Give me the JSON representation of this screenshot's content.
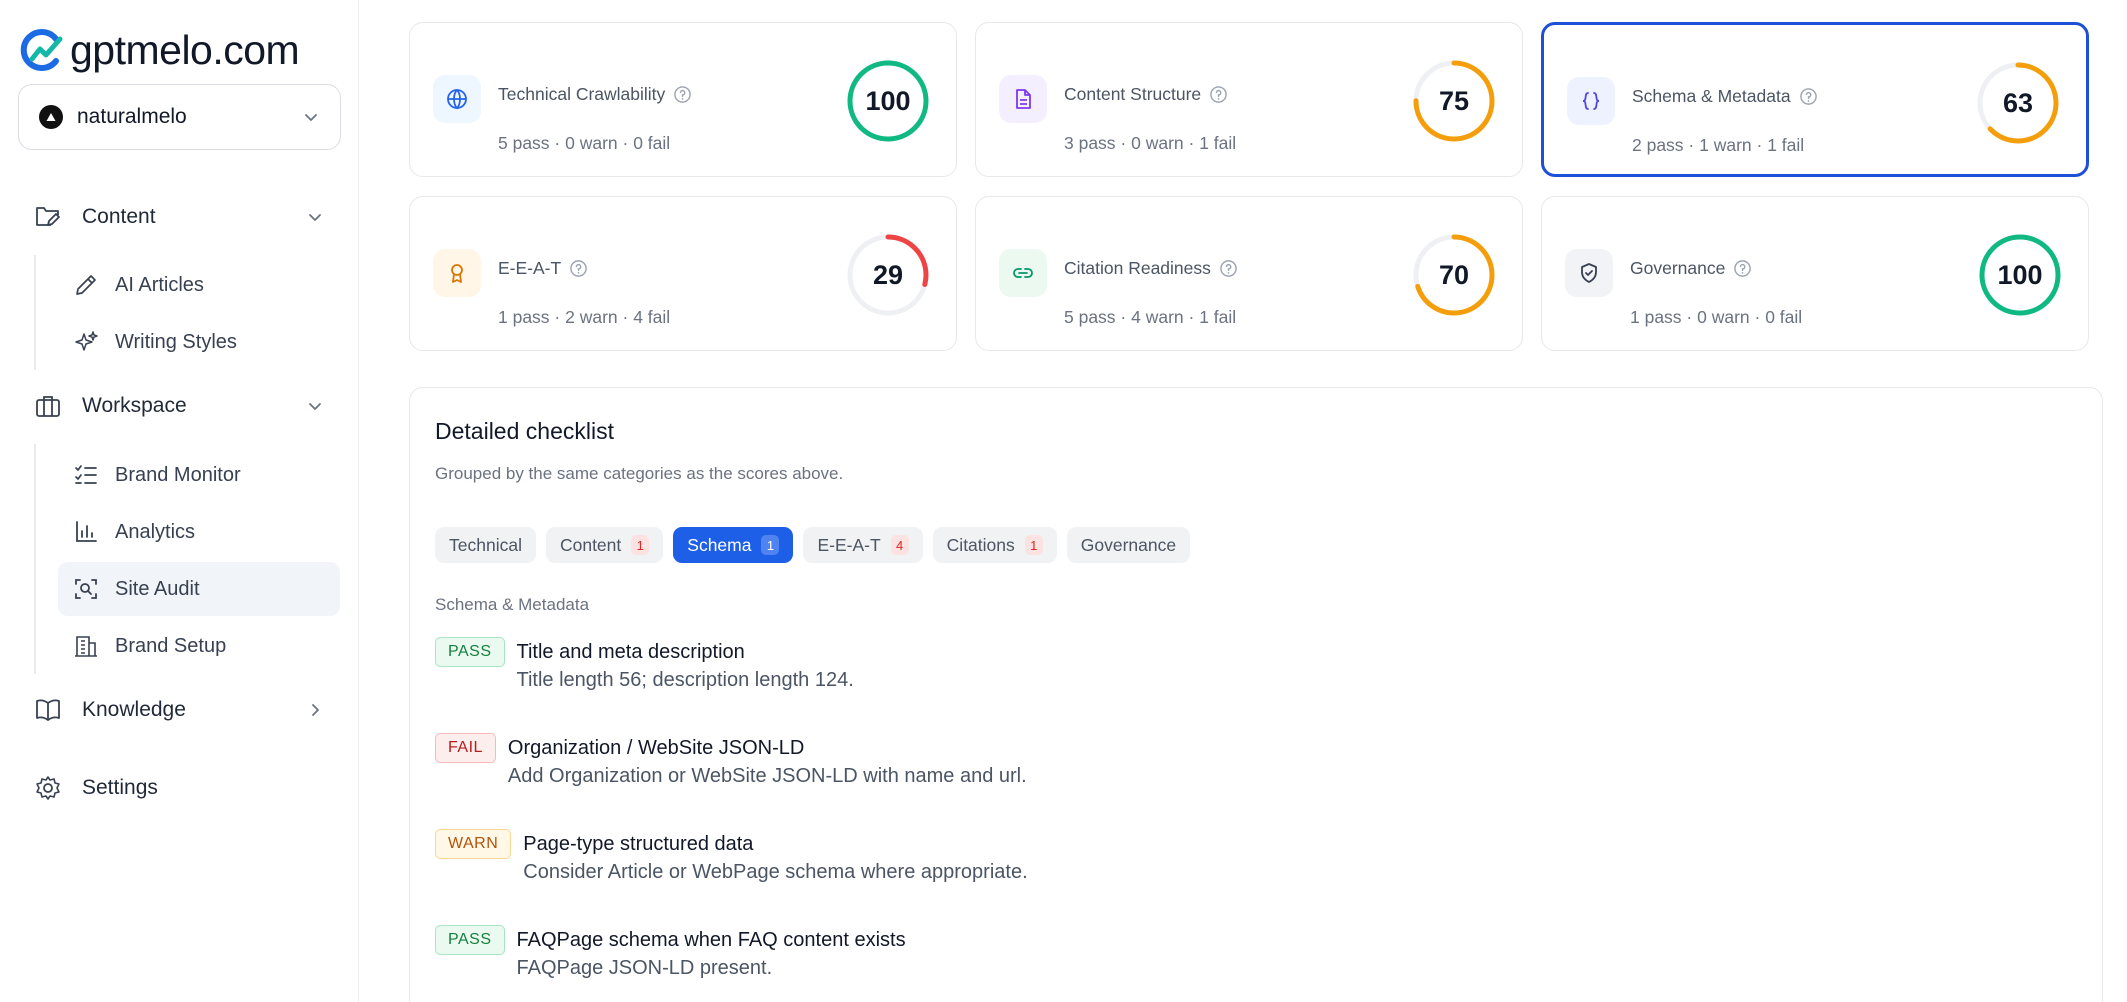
{
  "brand": {
    "name": "gptmelo.com"
  },
  "workspace": {
    "name": "naturalmelo"
  },
  "sidebar": {
    "sections": [
      {
        "label": "Content",
        "items": [
          {
            "label": "AI Articles"
          },
          {
            "label": "Writing Styles"
          }
        ]
      },
      {
        "label": "Workspace",
        "items": [
          {
            "label": "Brand Monitor"
          },
          {
            "label": "Analytics"
          },
          {
            "label": "Site Audit",
            "active": true
          },
          {
            "label": "Brand Setup"
          }
        ]
      },
      {
        "label": "Knowledge"
      },
      {
        "label": "Settings"
      }
    ]
  },
  "cards": [
    {
      "title": "Technical Crawlability",
      "summary": "5 pass · 0 warn · 0 fail",
      "score": "100",
      "score_value": 100,
      "color": "#10b981",
      "icon": "globe-icon"
    },
    {
      "title": "Content Structure",
      "summary": "3 pass · 0 warn · 1 fail",
      "score": "75",
      "score_value": 75,
      "color": "#f59e0b",
      "icon": "document-icon"
    },
    {
      "title": "Schema & Metadata",
      "summary": "2 pass · 1 warn · 1 fail",
      "score": "63",
      "score_value": 63,
      "color": "#f59e0b",
      "icon": "braces-icon",
      "selected": true
    },
    {
      "title": "E-E-A-T",
      "summary": "1 pass · 2 warn · 4 fail",
      "score": "29",
      "score_value": 29,
      "color": "#ef4444",
      "icon": "award-icon"
    },
    {
      "title": "Citation Readiness",
      "summary": "5 pass · 4 warn · 1 fail",
      "score": "70",
      "score_value": 70,
      "color": "#f59e0b",
      "icon": "link-icon"
    },
    {
      "title": "Governance",
      "summary": "1 pass · 0 warn · 0 fail",
      "score": "100",
      "score_value": 100,
      "color": "#10b981",
      "icon": "shield-icon"
    }
  ],
  "checklist": {
    "title": "Detailed checklist",
    "subtitle": "Grouped by the same categories as the scores above.",
    "tabs": [
      {
        "label": "Technical",
        "badge": ""
      },
      {
        "label": "Content",
        "badge": "1"
      },
      {
        "label": "Schema",
        "badge": "1",
        "active": true
      },
      {
        "label": "E-E-A-T",
        "badge": "4"
      },
      {
        "label": "Citations",
        "badge": "1"
      },
      {
        "label": "Governance",
        "badge": ""
      }
    ],
    "group": "Schema & Metadata",
    "items": [
      {
        "status": "PASS",
        "title": "Title and meta description",
        "detail": "Title length 56; description length 124."
      },
      {
        "status": "FAIL",
        "title": "Organization / WebSite JSON-LD",
        "detail": "Add Organization or WebSite JSON-LD with name and url."
      },
      {
        "status": "WARN",
        "title": "Page-type structured data",
        "detail": "Consider Article or WebPage schema where appropriate."
      },
      {
        "status": "PASS",
        "title": "FAQPage schema when FAQ content exists",
        "detail": "FAQPage JSON-LD present."
      }
    ]
  }
}
